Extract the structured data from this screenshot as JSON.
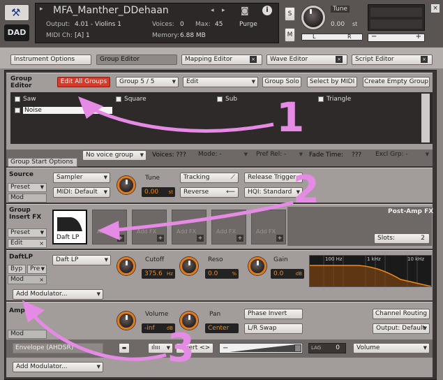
{
  "header": {
    "instrument_name": "MFA_Manther_DDehaan",
    "output_label": "Output:",
    "output_value": "4.01 - Violins 1",
    "midi_label": "MIDI Ch:",
    "midi_value": "[A] 1",
    "voices_label": "Voices:",
    "voices_value": "0",
    "max_label": "Max:",
    "max_value": "45",
    "memory_label": "Memory:",
    "memory_value": "6.88 MB",
    "purge_label": "Purge",
    "s_label": "S",
    "m_label": "M",
    "tune_label": "Tune",
    "tune_value": "0.00",
    "tune_unit": "st",
    "logo": "DAD",
    "pan_l": "L",
    "pan_r": "R"
  },
  "tabs": [
    "Instrument Options",
    "Group Editor",
    "Mapping Editor",
    "Wave Editor",
    "Script Editor"
  ],
  "group_editor": {
    "label": "Group Editor",
    "edit_all": "Edit All Groups",
    "group_sel": "Group 5 / 5",
    "edit_menu": "Edit",
    "group_solo": "Group Solo",
    "select_midi": "Select by MIDI",
    "create_empty": "Create Empty Group",
    "groups": [
      "Saw",
      "Square",
      "Sub",
      "Triangle",
      "Noise"
    ]
  },
  "group_start": {
    "tab": "Group Start Options",
    "voice_group": "No voice group",
    "voices": "Voices: ???",
    "mode": "Mode: -",
    "pref_rel": "Pref Rel: -",
    "fade_time": "Fade Time:",
    "fade_val": "???",
    "excl_grp": "Excl Grp: -"
  },
  "source": {
    "label": "Source",
    "preset": "Preset",
    "mod": "Mod",
    "sampler": "Sampler",
    "midi_default": "MIDI: Default",
    "tune_label": "Tune",
    "tune_value": "0.00",
    "tune_unit": "st",
    "tracking": "Tracking",
    "reverse": "Reverse",
    "release_trigger": "Release Trigger",
    "hqi": "HQI: Standard"
  },
  "insert_fx": {
    "label": "Group Insert FX",
    "preset": "Preset",
    "edit": "Edit",
    "slot1": "Daft LP",
    "add_fx": "Add FX",
    "post_amp": "Post-Amp FX",
    "slots_label": "Slots:",
    "slots_value": "2"
  },
  "daftlp": {
    "label": "DaftLP",
    "byp": "Byp",
    "pre": "Pre",
    "mod": "Mod",
    "type": "Daft LP",
    "cutoff_label": "Cutoff",
    "cutoff_value": "375.6",
    "cutoff_unit": "Hz",
    "reso_label": "Reso",
    "reso_value": "0.0",
    "reso_unit": "%",
    "gain_label": "Gain",
    "gain_value": "0.0",
    "gain_unit": "dB",
    "freq_labels": [
      "100 Hz",
      "1 kHz",
      "10 kHz"
    ],
    "add_modulator": "Add Modulator..."
  },
  "amp": {
    "label": "Amp",
    "mod": "Mod",
    "volume_label": "Volume",
    "volume_value": "-inf",
    "volume_unit": "dB",
    "pan_label": "Pan",
    "pan_value": "Center",
    "phase_invert": "Phase Invert",
    "lr_swap": "L/R Swap",
    "channel_routing": "Channel Routing",
    "output_default": "Output: Default",
    "envelope": "Envelope (AHDSR)",
    "invert": "Invert",
    "lag_label": "LAG",
    "lag_value": "0",
    "volume_target": "Volume",
    "add_modulator": "Add Modulator..."
  },
  "annotations": [
    "1",
    "2",
    "3"
  ],
  "colors": {
    "accent": "#e07a1a",
    "annotation": "#e58ae5",
    "edit_all_red": "#d83a2a"
  }
}
